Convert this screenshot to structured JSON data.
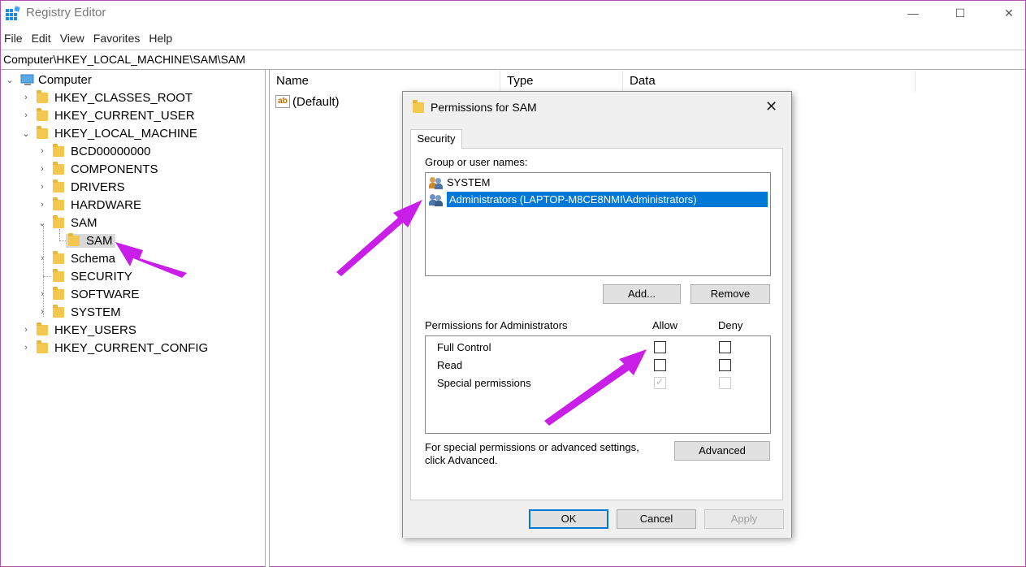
{
  "window": {
    "title": "Registry Editor",
    "controls": {
      "minimize": "—",
      "maximize": "☐",
      "close": "✕"
    }
  },
  "menu": [
    "File",
    "Edit",
    "View",
    "Favorites",
    "Help"
  ],
  "address": "Computer\\HKEY_LOCAL_MACHINE\\SAM\\SAM",
  "tree": {
    "root": "Computer",
    "hives": [
      "HKEY_CLASSES_ROOT",
      "HKEY_CURRENT_USER",
      "HKEY_LOCAL_MACHINE",
      "HKEY_USERS",
      "HKEY_CURRENT_CONFIG"
    ],
    "hklm_children": [
      "BCD00000000",
      "COMPONENTS",
      "DRIVERS",
      "HARDWARE",
      "SAM",
      "Schema",
      "SECURITY",
      "SOFTWARE",
      "SYSTEM"
    ],
    "sam_child": "SAM"
  },
  "list": {
    "columns": [
      "Name",
      "Type",
      "Data"
    ],
    "rows": [
      {
        "icon": "ab",
        "name": "(Default)"
      }
    ]
  },
  "dialog": {
    "title": "Permissions for SAM",
    "tab": "Security",
    "group_label": "Group or user names:",
    "users": [
      "SYSTEM",
      "Administrators (LAPTOP-M8CE8NMI\\Administrators)"
    ],
    "add_button": "Add...",
    "remove_button": "Remove",
    "permissions_label": "Permissions for Administrators",
    "allow_label": "Allow",
    "deny_label": "Deny",
    "permissions": [
      {
        "name": "Full Control",
        "allow": false,
        "deny": false,
        "disabled": false
      },
      {
        "name": "Read",
        "allow": false,
        "deny": false,
        "disabled": false
      },
      {
        "name": "Special permissions",
        "allow": true,
        "deny": false,
        "disabled": true
      }
    ],
    "advanced_note_line1": "For special permissions or advanced settings,",
    "advanced_note_line2": "click Advanced.",
    "advanced_button": "Advanced",
    "ok_button": "OK",
    "cancel_button": "Cancel",
    "apply_button": "Apply"
  },
  "colors": {
    "selection": "#0078d7",
    "annotation_arrow": "#c81ee8",
    "folder": "#f4c84f"
  }
}
